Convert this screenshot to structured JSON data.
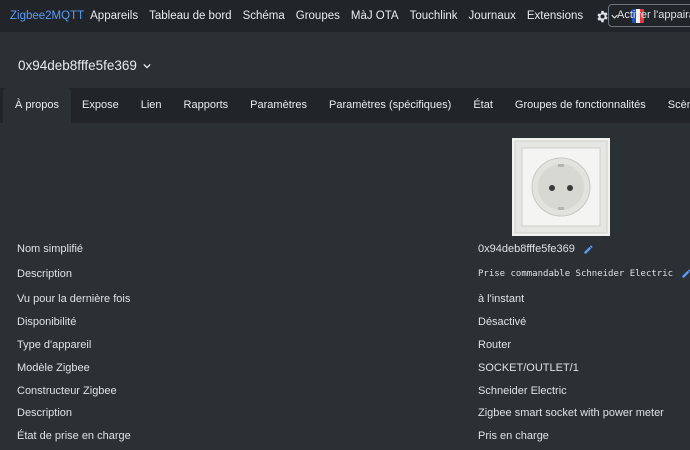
{
  "navbar": {
    "brand": "Zigbee2MQTT",
    "links": [
      "Appareils",
      "Tableau de bord",
      "Schéma",
      "Groupes",
      "MàJ OTA",
      "Touchlink",
      "Journaux",
      "Extensions"
    ],
    "settings_icon": "gear-icon",
    "language_flag": "flag-fr-icon",
    "permit_join_label": "Activer l'appairage"
  },
  "device": {
    "friendly_name": "0x94deb8fffe5fe369",
    "dropdown_icon": "chevron-down-icon"
  },
  "tabs": [
    "À propos",
    "Expose",
    "Lien",
    "Rapports",
    "Paramètres",
    "Paramètres (spécifiques)",
    "État",
    "Groupes de fonctionnalités",
    "Scène"
  ],
  "active_tab": "À propos",
  "info": {
    "rows": [
      {
        "label": "Nom simplifié",
        "value": "0x94deb8fffe5fe369"
      },
      {
        "label": "Description",
        "value": "Prise commandable Schneider Electric"
      },
      {
        "label": "Vu pour la dernière fois",
        "value": "à l'instant"
      },
      {
        "label": "Disponibilité",
        "value": "Désactivé"
      },
      {
        "label": "Type d'appareil",
        "value": "Router"
      },
      {
        "label": "Modèle Zigbee",
        "value": "SOCKET/OUTLET/1"
      },
      {
        "label": "Constructeur Zigbee",
        "value": "Schneider Electric"
      },
      {
        "label": "Description",
        "value": "Zigbee smart socket with power meter"
      },
      {
        "label": "État de prise en charge",
        "value": "Pris en charge"
      }
    ]
  },
  "colors": {
    "brand": "#5a9cf8",
    "link": "#5a9cf8",
    "supported": "#57c27f",
    "navbar_bg": "#212529",
    "page_bg": "#2b3035"
  }
}
